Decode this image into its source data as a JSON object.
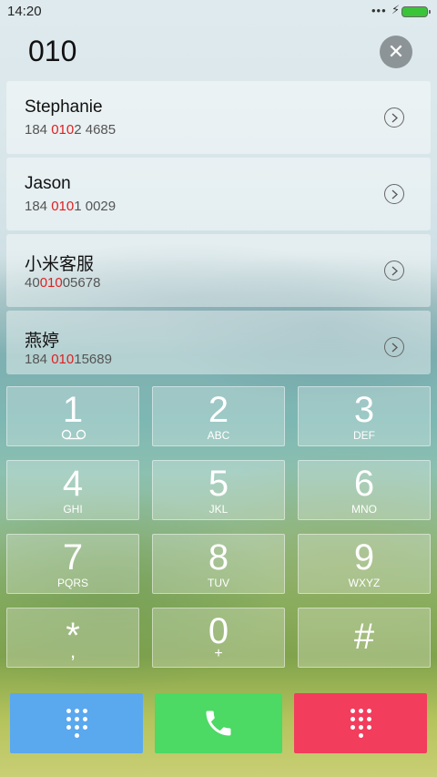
{
  "status": {
    "time": "14:20",
    "more": "•••",
    "charging": "⚡"
  },
  "dialer": {
    "input": "010"
  },
  "results": [
    {
      "name": "Stephanie",
      "pre": "184 ",
      "match": "010",
      "post": "2 4685"
    },
    {
      "name": "Jason",
      "pre": "184 ",
      "match": "010",
      "post": "1 0029"
    },
    {
      "name": "小米客服",
      "pre": "40",
      "match": "010",
      "post": "05678"
    },
    {
      "name": "燕婷",
      "pre": "184 ",
      "match": "010",
      "post": "15689"
    }
  ],
  "keys": [
    {
      "digit": "1",
      "letters": ""
    },
    {
      "digit": "2",
      "letters": "ABC"
    },
    {
      "digit": "3",
      "letters": "DEF"
    },
    {
      "digit": "4",
      "letters": "GHI"
    },
    {
      "digit": "5",
      "letters": "JKL"
    },
    {
      "digit": "6",
      "letters": "MNO"
    },
    {
      "digit": "7",
      "letters": "PQRS"
    },
    {
      "digit": "8",
      "letters": "TUV"
    },
    {
      "digit": "9",
      "letters": "WXYZ"
    },
    {
      "digit": "*",
      "letters": ","
    },
    {
      "digit": "0",
      "letters": "+"
    },
    {
      "digit": "#",
      "letters": ""
    }
  ],
  "icons": {
    "clear": "close-icon",
    "detail": "chevron-right-circle-icon",
    "voicemail": "voicemail-icon",
    "keypad": "dialpad-icon",
    "call": "phone-icon"
  },
  "colors": {
    "highlight": "#e02020",
    "left_button": "#5aa8ee",
    "call_button": "#4cd964",
    "right_button": "#f23d5c",
    "battery": "#3ac43a"
  }
}
